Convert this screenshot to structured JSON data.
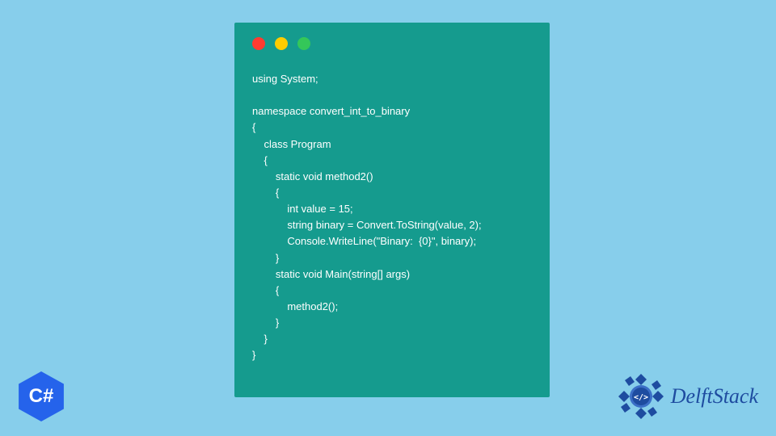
{
  "window": {
    "dots": {
      "red": "#ff3b30",
      "yellow": "#ffcc00",
      "green": "#34c759"
    }
  },
  "code": {
    "lines": "using System;\n\nnamespace convert_int_to_binary\n{\n    class Program\n    {\n        static void method2()\n        {\n            int value = 15;\n            string binary = Convert.ToString(value, 2);\n            Console.WriteLine(\"Binary:  {0}\", binary);\n        }\n        static void Main(string[] args)\n        {\n            method2();\n        }\n    }\n}"
  },
  "badges": {
    "csharp": "C#",
    "delftstack": "DelftStack"
  },
  "colors": {
    "background": "#87ceeb",
    "window": "#159b8e",
    "csharp_hex": "#2563eb",
    "delftstack_text": "#1e4ca0"
  }
}
